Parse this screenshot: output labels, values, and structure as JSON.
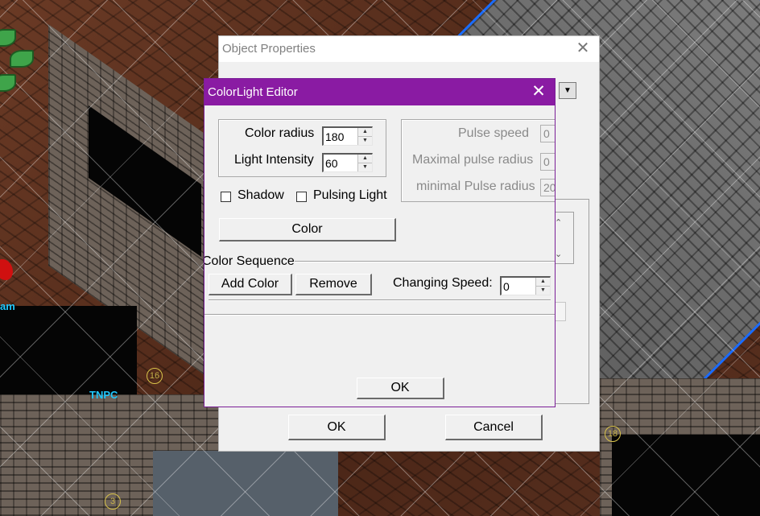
{
  "game": {
    "npc_label": "TNPC",
    "name_label_partial": "am",
    "markers": [
      "16",
      "18",
      "3"
    ]
  },
  "object_properties": {
    "title": "Object Properties",
    "close_glyph": "✕",
    "combo_arrow": "▼",
    "scroll_up": "⌃",
    "scroll_down": "⌄",
    "ok_label": "OK",
    "cancel_label": "Cancel"
  },
  "colorlight_editor": {
    "title": "ColorLight Editor",
    "close_glyph": "✕",
    "color_radius_label": "Color radius",
    "color_radius_value": "180",
    "light_intensity_label": "Light Intensity",
    "light_intensity_value": "60",
    "pulse_speed_label": "Pulse speed",
    "pulse_speed_value": "0",
    "max_pulse_radius_label": "Maximal pulse radius",
    "max_pulse_radius_value": "0",
    "min_pulse_radius_label": "minimal Pulse radius",
    "min_pulse_radius_value": "20",
    "shadow_label": "Shadow",
    "shadow_checked": false,
    "pulsing_light_label": "Pulsing Light",
    "pulsing_light_checked": false,
    "color_button_label": "Color",
    "color_sequence_label": "Color Sequence",
    "add_color_label": "Add Color",
    "remove_label": "Remove",
    "changing_speed_label": "Changing Speed:",
    "changing_speed_value": "0",
    "ok_label": "OK",
    "spin_up": "▲",
    "spin_down": "▼"
  },
  "colors": {
    "editor_titlebar": "#8a1ba3",
    "roof_outline": "#1a6cff",
    "npc_label": "#1ec8ff"
  }
}
